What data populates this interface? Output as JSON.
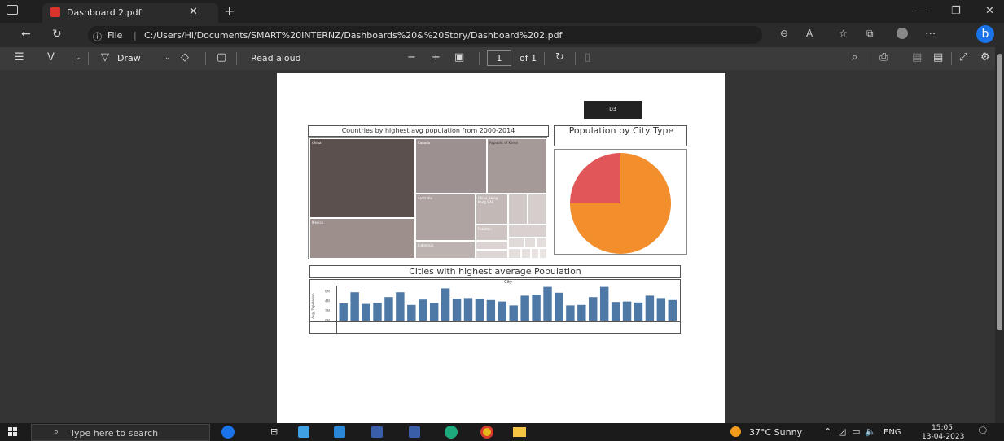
{
  "browser": {
    "tab_title": "Dashboard 2.pdf",
    "file_label": "File",
    "url": "C:/Users/Hi/Documents/SMART%20INTERNZ/Dashboards%20&%20Story/Dashboard%202.pdf"
  },
  "pdf_toolbar": {
    "draw_label": "Draw",
    "read_aloud_label": "Read aloud",
    "page_number": "1",
    "page_total": "of 1"
  },
  "dashboard": {
    "button_label": "D3",
    "treemap_title": "Countries by highest avg population from 2000-2014",
    "pie_title": "Population by City Type",
    "bar_title": "Cities with highest average Population",
    "bar_axis_header": "City",
    "bar_ylabel": "Avg. Population",
    "treemap_labels": {
      "china": "China",
      "canada": "Canada",
      "korea": "Republic of Korea",
      "mexico": "Mexico",
      "australia": "Australia",
      "hongkong": "China, Hong Kong SAR",
      "pakistan": "Pakistan",
      "indonesia": "Indonesia"
    },
    "pie_colors": {
      "main": "#f28e2b",
      "second": "#e15759"
    }
  },
  "chart_data": [
    {
      "type": "pie",
      "title": "Population by City Type",
      "values": [
        0.75,
        0.25
      ],
      "colors": [
        "#f28e2b",
        "#e15759"
      ]
    },
    {
      "type": "bar",
      "title": "Cities with highest average Population",
      "xlabel": "City",
      "ylabel": "Avg. Population",
      "y_ticks": [
        "6M",
        "4M",
        "2M",
        "0M"
      ],
      "ylim": [
        0,
        7
      ],
      "values": [
        3.5,
        5.8,
        3.4,
        3.6,
        4.8,
        5.8,
        3.2,
        4.3,
        3.6,
        6.6,
        4.5,
        4.6,
        4.4,
        4.2,
        3.9,
        3.1,
        5.1,
        5.3,
        6.9,
        5.7,
        3.1,
        3.2,
        4.8,
        6.9,
        3.8,
        3.9,
        3.7,
        5.1,
        4.6,
        4.2
      ],
      "color": "#4e79a7"
    }
  ],
  "taskbar": {
    "search_placeholder": "Type here to search",
    "weather": "37°C  Sunny",
    "language": "ENG",
    "time": "15:05",
    "date": "13-04-2023"
  }
}
